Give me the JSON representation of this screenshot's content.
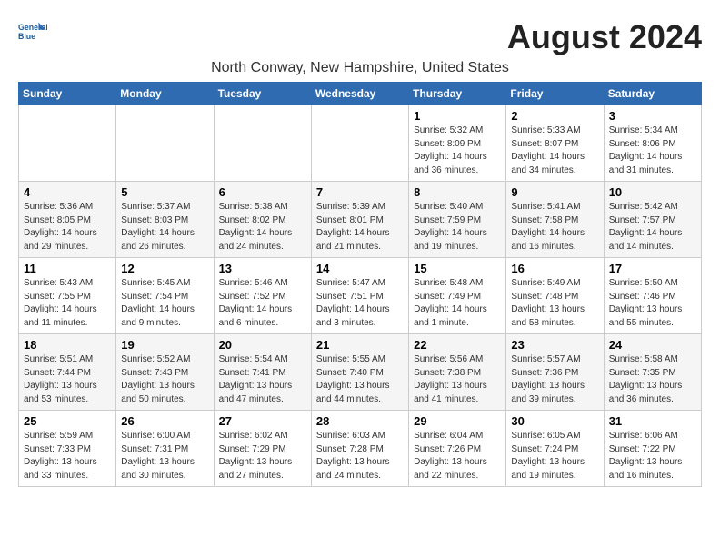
{
  "header": {
    "logo_line1": "General",
    "logo_line2": "Blue",
    "month_year": "August 2024",
    "location": "North Conway, New Hampshire, United States"
  },
  "weekdays": [
    "Sunday",
    "Monday",
    "Tuesday",
    "Wednesday",
    "Thursday",
    "Friday",
    "Saturday"
  ],
  "weeks": [
    [
      {
        "day": "",
        "info": ""
      },
      {
        "day": "",
        "info": ""
      },
      {
        "day": "",
        "info": ""
      },
      {
        "day": "",
        "info": ""
      },
      {
        "day": "1",
        "info": "Sunrise: 5:32 AM\nSunset: 8:09 PM\nDaylight: 14 hours\nand 36 minutes."
      },
      {
        "day": "2",
        "info": "Sunrise: 5:33 AM\nSunset: 8:07 PM\nDaylight: 14 hours\nand 34 minutes."
      },
      {
        "day": "3",
        "info": "Sunrise: 5:34 AM\nSunset: 8:06 PM\nDaylight: 14 hours\nand 31 minutes."
      }
    ],
    [
      {
        "day": "4",
        "info": "Sunrise: 5:36 AM\nSunset: 8:05 PM\nDaylight: 14 hours\nand 29 minutes."
      },
      {
        "day": "5",
        "info": "Sunrise: 5:37 AM\nSunset: 8:03 PM\nDaylight: 14 hours\nand 26 minutes."
      },
      {
        "day": "6",
        "info": "Sunrise: 5:38 AM\nSunset: 8:02 PM\nDaylight: 14 hours\nand 24 minutes."
      },
      {
        "day": "7",
        "info": "Sunrise: 5:39 AM\nSunset: 8:01 PM\nDaylight: 14 hours\nand 21 minutes."
      },
      {
        "day": "8",
        "info": "Sunrise: 5:40 AM\nSunset: 7:59 PM\nDaylight: 14 hours\nand 19 minutes."
      },
      {
        "day": "9",
        "info": "Sunrise: 5:41 AM\nSunset: 7:58 PM\nDaylight: 14 hours\nand 16 minutes."
      },
      {
        "day": "10",
        "info": "Sunrise: 5:42 AM\nSunset: 7:57 PM\nDaylight: 14 hours\nand 14 minutes."
      }
    ],
    [
      {
        "day": "11",
        "info": "Sunrise: 5:43 AM\nSunset: 7:55 PM\nDaylight: 14 hours\nand 11 minutes."
      },
      {
        "day": "12",
        "info": "Sunrise: 5:45 AM\nSunset: 7:54 PM\nDaylight: 14 hours\nand 9 minutes."
      },
      {
        "day": "13",
        "info": "Sunrise: 5:46 AM\nSunset: 7:52 PM\nDaylight: 14 hours\nand 6 minutes."
      },
      {
        "day": "14",
        "info": "Sunrise: 5:47 AM\nSunset: 7:51 PM\nDaylight: 14 hours\nand 3 minutes."
      },
      {
        "day": "15",
        "info": "Sunrise: 5:48 AM\nSunset: 7:49 PM\nDaylight: 14 hours\nand 1 minute."
      },
      {
        "day": "16",
        "info": "Sunrise: 5:49 AM\nSunset: 7:48 PM\nDaylight: 13 hours\nand 58 minutes."
      },
      {
        "day": "17",
        "info": "Sunrise: 5:50 AM\nSunset: 7:46 PM\nDaylight: 13 hours\nand 55 minutes."
      }
    ],
    [
      {
        "day": "18",
        "info": "Sunrise: 5:51 AM\nSunset: 7:44 PM\nDaylight: 13 hours\nand 53 minutes."
      },
      {
        "day": "19",
        "info": "Sunrise: 5:52 AM\nSunset: 7:43 PM\nDaylight: 13 hours\nand 50 minutes."
      },
      {
        "day": "20",
        "info": "Sunrise: 5:54 AM\nSunset: 7:41 PM\nDaylight: 13 hours\nand 47 minutes."
      },
      {
        "day": "21",
        "info": "Sunrise: 5:55 AM\nSunset: 7:40 PM\nDaylight: 13 hours\nand 44 minutes."
      },
      {
        "day": "22",
        "info": "Sunrise: 5:56 AM\nSunset: 7:38 PM\nDaylight: 13 hours\nand 41 minutes."
      },
      {
        "day": "23",
        "info": "Sunrise: 5:57 AM\nSunset: 7:36 PM\nDaylight: 13 hours\nand 39 minutes."
      },
      {
        "day": "24",
        "info": "Sunrise: 5:58 AM\nSunset: 7:35 PM\nDaylight: 13 hours\nand 36 minutes."
      }
    ],
    [
      {
        "day": "25",
        "info": "Sunrise: 5:59 AM\nSunset: 7:33 PM\nDaylight: 13 hours\nand 33 minutes."
      },
      {
        "day": "26",
        "info": "Sunrise: 6:00 AM\nSunset: 7:31 PM\nDaylight: 13 hours\nand 30 minutes."
      },
      {
        "day": "27",
        "info": "Sunrise: 6:02 AM\nSunset: 7:29 PM\nDaylight: 13 hours\nand 27 minutes."
      },
      {
        "day": "28",
        "info": "Sunrise: 6:03 AM\nSunset: 7:28 PM\nDaylight: 13 hours\nand 24 minutes."
      },
      {
        "day": "29",
        "info": "Sunrise: 6:04 AM\nSunset: 7:26 PM\nDaylight: 13 hours\nand 22 minutes."
      },
      {
        "day": "30",
        "info": "Sunrise: 6:05 AM\nSunset: 7:24 PM\nDaylight: 13 hours\nand 19 minutes."
      },
      {
        "day": "31",
        "info": "Sunrise: 6:06 AM\nSunset: 7:22 PM\nDaylight: 13 hours\nand 16 minutes."
      }
    ]
  ]
}
